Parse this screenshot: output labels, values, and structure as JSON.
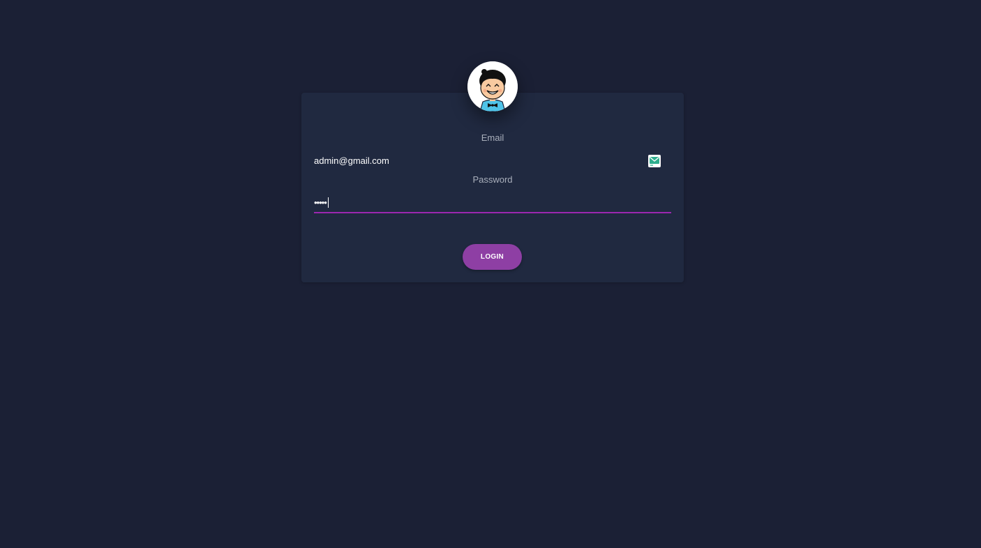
{
  "login_form": {
    "email_label": "Email",
    "email_value": "admin@gmail.com",
    "password_label": "Password",
    "password_masked": "•••••",
    "login_label": "LOGIN"
  },
  "icons": {
    "avatar": "avatar-cartoon-boy-icon",
    "email_adornment": "mail-icon"
  },
  "colors": {
    "background": "#1b2035",
    "card": "#202940",
    "accent": "#9c27b0",
    "button": "#8e3fa4"
  }
}
